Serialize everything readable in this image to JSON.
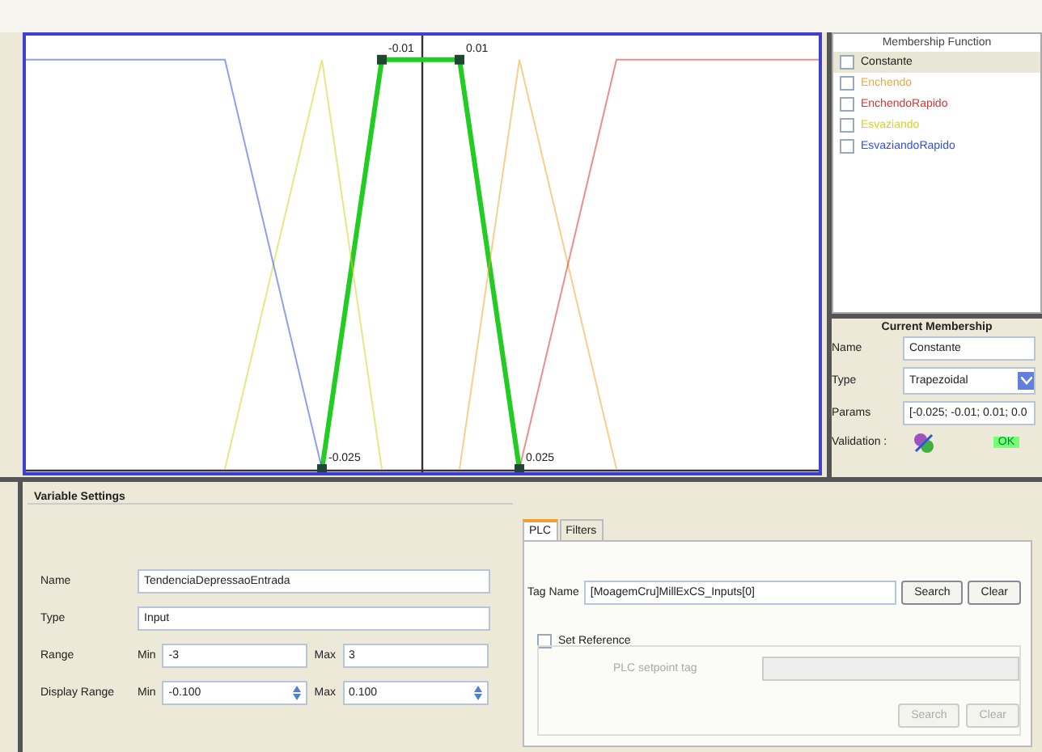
{
  "plot": {
    "point_labels": [
      "-0.025",
      "-0.01",
      "0.01",
      "0.025"
    ]
  },
  "membership_function": {
    "title": "Membership Function",
    "items": [
      {
        "label": "Constante",
        "color": "#202020",
        "selected": true,
        "checked": false
      },
      {
        "label": "Enchendo",
        "color": "#f0a830",
        "selected": false,
        "checked": false
      },
      {
        "label": "EnchendoRapido",
        "color": "#e03030",
        "selected": false,
        "checked": false
      },
      {
        "label": "Esvaziando",
        "color": "#d4d420",
        "selected": false,
        "checked": false
      },
      {
        "label": "EsvaziandoRapido",
        "color": "#3050e0",
        "selected": false,
        "checked": false
      }
    ]
  },
  "current_membership": {
    "title": "Current Membership",
    "name_label": "Name",
    "name": "Constante",
    "type_label": "Type",
    "type": "Trapezoidal",
    "params_label": "Params",
    "params": "[-0.025; -0.01; 0.01; 0.0",
    "validation_label": "Validation :",
    "validation_status": "OK"
  },
  "variable_settings": {
    "title": "Variable Settings",
    "name_label": "Name",
    "name": "TendenciaDepressaoEntrada",
    "type_label": "Type",
    "type": "Input",
    "range_label": "Range",
    "range_min_label": "Min",
    "range_min": "-3",
    "range_max_label": "Max",
    "range_max": "3",
    "display_range_label": "Display Range",
    "display_min_label": "Min",
    "display_min": "-0.100",
    "display_max_label": "Max",
    "display_max": "0.100"
  },
  "plc": {
    "tabs": [
      {
        "label": "PLC",
        "selected": true
      },
      {
        "label": "Filters",
        "selected": false
      }
    ],
    "tag_name_label": "Tag Name",
    "tag_name": "[MoagemCru]MillExCS_Inputs[0]",
    "buttons": [
      "Search",
      "Clear"
    ],
    "set_reference": {
      "label": "Set Reference",
      "checked": false
    },
    "setpoint_label": "PLC setpoint tag",
    "reference_buttons": [
      "Search",
      "Clear"
    ]
  }
}
